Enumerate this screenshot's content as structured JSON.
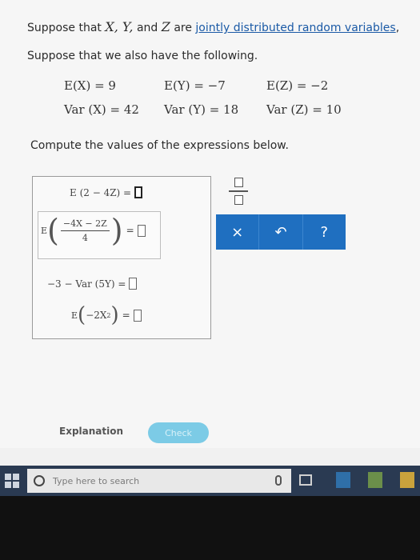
{
  "problem": {
    "intro_prefix": "Suppose that ",
    "intro_vars": "X, Y,",
    "intro_and": " and ",
    "intro_z": "Z",
    "intro_are": " are ",
    "intro_link": "jointly distributed random variables",
    "intro_tail": ",",
    "also_text": "Suppose that we also have the following.",
    "givens": [
      "E(X) = 9",
      "E(Y) = −7",
      "E(Z) = −2",
      "Var (X) = 42",
      "Var (Y) = 18",
      "Var (Z) = 10"
    ],
    "compute_text": "Compute the values of the expressions below."
  },
  "expressions": {
    "e1": "E (2 − 4Z) =",
    "e2_prefix": "E",
    "e2_num": "−4X − 2Z",
    "e2_den": "4",
    "e2_eq": "=",
    "e3": "−3 − Var (5Y) =",
    "e4_prefix": "E",
    "e4_inner": "−2X",
    "e4_exp": "2",
    "e4_eq": "="
  },
  "toolbar": {
    "clear_label": "×",
    "undo_label": "↶",
    "help_label": "?"
  },
  "footer": {
    "explanation_label": "Explanation",
    "check_label": "Check"
  },
  "taskbar": {
    "search_placeholder": "Type here to search"
  },
  "colors": {
    "accent": "#1f6fc0",
    "link": "#1b5aa6",
    "check": "#7ccbe6",
    "taskbar": "#2a3a52"
  }
}
